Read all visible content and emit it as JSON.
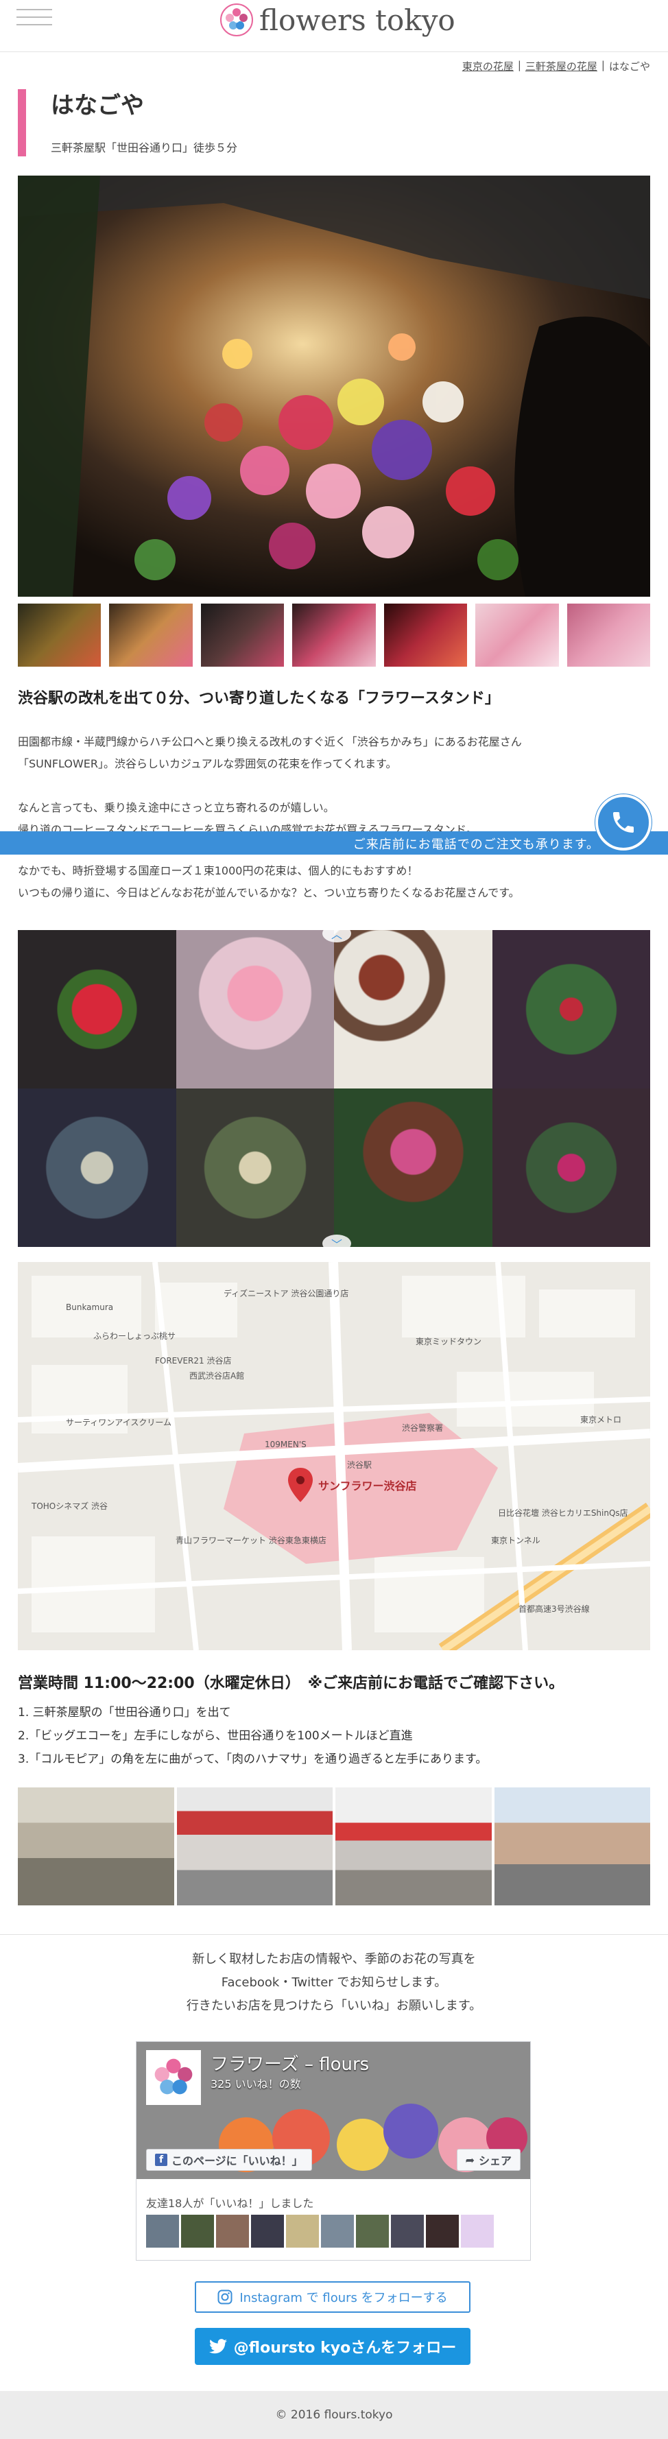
{
  "header": {
    "logo_text": "flowers tokyo",
    "menu_icon": "hamburger-menu-icon"
  },
  "breadcrumb": [
    "東京の花屋",
    "三軒茶屋の花屋",
    "はなごや"
  ],
  "shop": {
    "name": "はなごや",
    "access": "三軒茶屋駅「世田谷通り口」徒歩５分"
  },
  "intro": {
    "headline": "渋谷駅の改札を出て０分、つい寄り道したくなる「フラワースタンド」",
    "para1_line1": "田園都市線・半蔵門線からハチ公口へと乗り換える改札のすぐ近く「渋谷ちかみち」にあるお花屋さん",
    "para1_line2": "「SUNFLOWER」。渋谷らしいカジュアルな雰囲気の花束を作ってくれます。",
    "para2_line1": "なんと言っても、乗り換え途中にさっと立ち寄れるのが嬉しい。",
    "para2_line2": "帰り道のコーヒースタンドでコーヒーを買うくらいの感覚でお花が買えるフラワースタンド。",
    "para3_line1": "なかでも、時折登場する国産ローズ１束1000円の花束は、個人的にもおすすめ！",
    "para3_line2": "いつもの帰り道に、今日はどんなお花が並んでいるかな？と、つい立ち寄りたくなるお花屋さんです。"
  },
  "phone_banner": {
    "text": "ご来店前にお電話でのご注文も承ります。",
    "icon": "phone-icon"
  },
  "map": {
    "shop_label": "サンフラワー渋谷店",
    "labels": [
      "ふらわーしょっぷ桃サ",
      "FOREVER21 渋谷店",
      "西武渋谷店A館",
      "サーティワンアイスクリーム",
      "TOHOシネマズ 渋谷",
      "青山フラワーマーケット 渋谷東急東横店",
      "東京メトロ",
      "渋谷駅",
      "首都高速3号渋谷線",
      "東京ミッドタウン",
      "ディズニーストア 渋谷公園通り店",
      "日比谷花壇 渋谷ヒカリエShinQs店",
      "東京トンネル",
      "渋谷警察署",
      "109MEN'S",
      "Bunkamura"
    ]
  },
  "hours": {
    "text": "営業時間 11:00～22:00（水曜定休日）　※ご来店前にお電話でご確認下さい。"
  },
  "directions": [
    "1. 三軒茶屋駅の「世田谷通り口」を出て",
    "2.「ビッグエコーを」左手にしながら、世田谷通りを100メートルほど直進",
    "3.「コルモピア」の角を左に曲がって、「肉のハナマサ」を通り過ぎると左手にあります。"
  ],
  "follow": {
    "line1": "新しく取材したお店の情報や、季節のお花の写真を",
    "line2": "Facebook・Twitter でお知らせします。",
    "line3": "行きたいお店を見つけたら「いいね」お願いします。"
  },
  "facebook": {
    "page_name": "フラワーズ – flours",
    "likes": "325 いいね！の数",
    "like_button": "このページに「いいね！」",
    "share_button": "シェア",
    "friends_text": "友達18人が「いいね！」しました"
  },
  "instagram": {
    "label": "Instagram で flours をフォローする"
  },
  "twitter": {
    "label": "@floursto kyoさんをフォロー"
  },
  "footer": {
    "copyright": "© 2016 flours.tokyo"
  },
  "colors": {
    "accent_pink": "#e8669c",
    "accent_blue": "#3b8fd9",
    "twitter_blue": "#1b95e0"
  }
}
